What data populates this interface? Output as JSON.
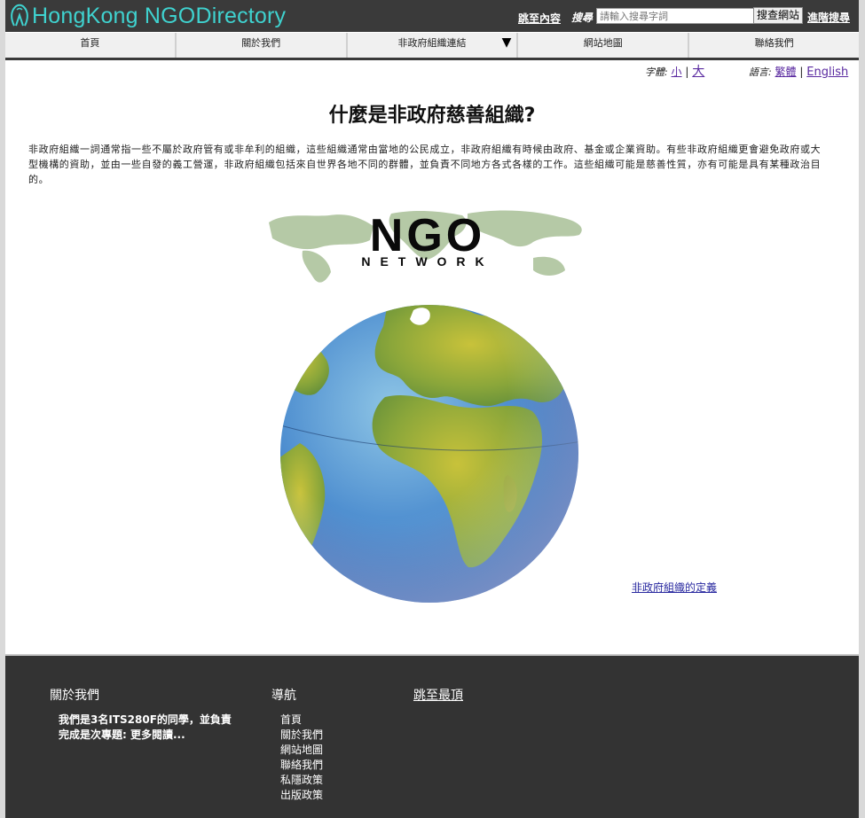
{
  "header": {
    "logo_text": "HongKong NGODirectory",
    "skip_link": "跳至內容",
    "search_label": "搜尋",
    "search_placeholder": "請輸入搜尋字詞",
    "search_button": "搜查網站",
    "advanced_link": "進階搜尋"
  },
  "nav": {
    "items": [
      {
        "label": "首頁"
      },
      {
        "label": "關於我們"
      },
      {
        "label": "非政府組織連結"
      },
      {
        "label": "網站地圖"
      },
      {
        "label": "聯絡我們"
      }
    ],
    "dropdown_arrow": "▼"
  },
  "utility": {
    "font_label": "字體:",
    "font_small": "小",
    "font_separator": "|",
    "font_large": "大",
    "lang_label": "語言:",
    "lang_trad": "繁體",
    "lang_separator": "|",
    "lang_english": "English"
  },
  "main": {
    "title": "什麼是非政府慈善組織?",
    "intro": "非政府組織一詞通常指一些不屬於政府管有或非牟利的組織，這些組織通常由當地的公民成立，非政府組織有時候由政府、基金或企業資助。有些非政府組織更會避免政府或大型機構的資助，並由一些自發的義工營運，非政府組織包括來自世界各地不同的群體，並負責不同地方各式各樣的工作。這些組織可能是慈善性質，亦有可能是具有某種政治目的。",
    "banner_big": "NGO",
    "banner_small": "NETWORK",
    "definition_link": "非政府組織的定義"
  },
  "footer": {
    "about_title": "關於我們",
    "about_text": "我們是3名ITS280F的同學，並負責完成是次專題: 更多閱讀...",
    "nav_title": "導航",
    "nav_links": [
      "首頁",
      "關於我們",
      "網站地圖",
      "聯絡我們",
      "私隱政策",
      "出版政策"
    ],
    "back_to_top": "跳至最頂"
  },
  "colors": {
    "header_bg": "#3a3a3a",
    "logo_accent": "#3fd2cf",
    "footer_bg": "#333333",
    "link": "#5a2aa0"
  }
}
